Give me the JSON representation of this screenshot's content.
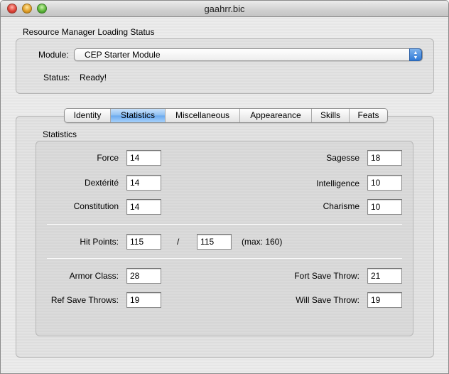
{
  "window": {
    "title": "gaahrr.bic"
  },
  "resource": {
    "group_title": "Resource Manager Loading Status",
    "module_label": "Module:",
    "module_value": "CEP Starter Module",
    "status_label": "Status:",
    "status_value": "Ready!"
  },
  "tabs": [
    {
      "label": "Identity",
      "selected": false
    },
    {
      "label": "Statistics",
      "selected": true
    },
    {
      "label": "Miscellaneous",
      "selected": false
    },
    {
      "label": "Appeareance",
      "selected": false
    },
    {
      "label": "Skills",
      "selected": false
    },
    {
      "label": "Feats",
      "selected": false
    }
  ],
  "statistics": {
    "group_title": "Statistics",
    "force": {
      "label": "Force",
      "value": "14"
    },
    "dexterite": {
      "label": "Dextérité",
      "value": "14"
    },
    "constitution": {
      "label": "Constitution",
      "value": "14"
    },
    "sagesse": {
      "label": "Sagesse",
      "value": "18"
    },
    "intelligence": {
      "label": "Intelligence",
      "value": "10"
    },
    "charisme": {
      "label": "Charisme",
      "value": "10"
    },
    "hit_points": {
      "label": "Hit Points:",
      "current": "115",
      "separator": "/",
      "max_value": "115",
      "max_note": "(max: 160)"
    },
    "armor_class": {
      "label": "Armor Class:",
      "value": "28"
    },
    "ref_save": {
      "label": "Ref Save Throws:",
      "value": "19"
    },
    "fort_save": {
      "label": "Fort Save Throw:",
      "value": "21"
    },
    "will_save": {
      "label": "Will Save Throw:",
      "value": "19"
    }
  },
  "colors": {
    "tab_selected": "#8cbef2",
    "popup_arrow": "#2f79d6"
  },
  "icons": {
    "popup_arrows": "up-down-arrows"
  }
}
